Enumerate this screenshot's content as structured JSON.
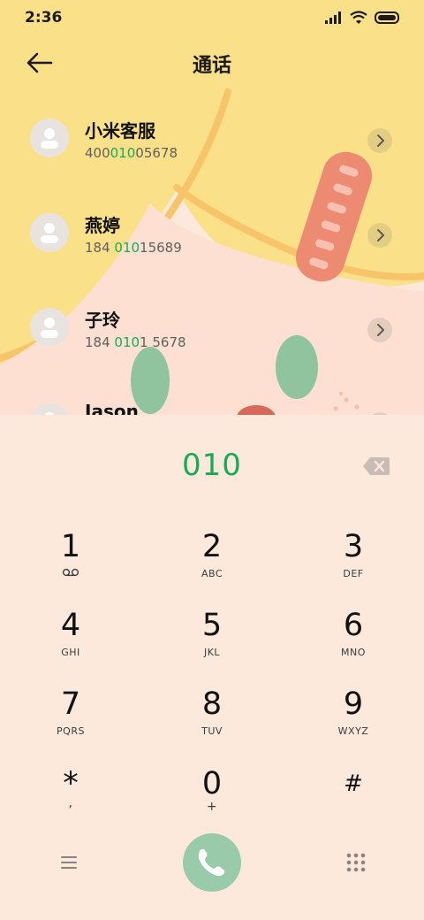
{
  "status_bar": {
    "time": "2:36"
  },
  "header": {
    "title": "通话"
  },
  "contacts": [
    {
      "name": "小米客服",
      "number_pre": "400",
      "number_match": "010",
      "number_post": "05678"
    },
    {
      "name": "燕婷",
      "number_pre": "184 ",
      "number_match": "010",
      "number_post": "15689"
    },
    {
      "name": "子玲",
      "number_pre": "184 ",
      "number_match": "010",
      "number_post": "1 5678"
    },
    {
      "name": "Jason",
      "number_pre": "",
      "number_match": "",
      "number_post": ""
    }
  ],
  "dialer": {
    "input": "010",
    "keys": [
      {
        "digit": "1",
        "letters": ""
      },
      {
        "digit": "2",
        "letters": "ABC"
      },
      {
        "digit": "3",
        "letters": "DEF"
      },
      {
        "digit": "4",
        "letters": "GHI"
      },
      {
        "digit": "5",
        "letters": "JKL"
      },
      {
        "digit": "6",
        "letters": "MNO"
      },
      {
        "digit": "7",
        "letters": "PQRS"
      },
      {
        "digit": "8",
        "letters": "TUV"
      },
      {
        "digit": "9",
        "letters": "WXYZ"
      },
      {
        "digit": "*",
        "letters": ","
      },
      {
        "digit": "0",
        "letters": "+"
      },
      {
        "digit": "#",
        "letters": ""
      }
    ]
  },
  "colors": {
    "accent_green": "#1aaa55",
    "call_button": "#99caa9",
    "background_yellow": "#fbe08a",
    "pad_background": "#fde8dc"
  }
}
